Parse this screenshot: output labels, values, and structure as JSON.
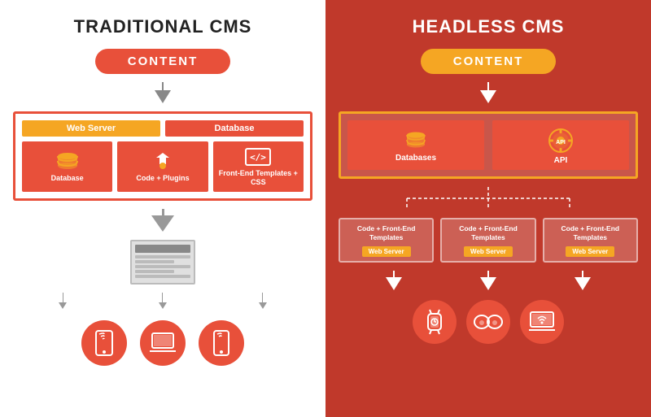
{
  "left": {
    "title": "TRADITIONAL CMS",
    "content_pill": "CONTENT",
    "server_labels": [
      "Web Server",
      "Database"
    ],
    "icon_cells": [
      {
        "label": "Database",
        "icon": "db"
      },
      {
        "label": "Code + Plugins",
        "icon": "plugin"
      },
      {
        "label": "Front-End Templates + CSS",
        "icon": "code"
      }
    ],
    "devices": [
      "📱",
      "💻",
      "📱"
    ]
  },
  "right": {
    "title": "HEADLESS CMS",
    "content_pill": "CONTENT",
    "icon_cells": [
      {
        "label": "Databases",
        "icon": "db"
      },
      {
        "label": "API",
        "icon": "api"
      }
    ],
    "webservers": [
      {
        "text": "Code + Front-End Templates",
        "label": "Web Server"
      },
      {
        "text": "Code + Front-End Templates",
        "label": "Web Server"
      },
      {
        "text": "Code + Front-End Templates",
        "label": "Web Server"
      }
    ],
    "devices": [
      "⌚",
      "🥽",
      "💻"
    ]
  },
  "colors": {
    "orange": "#f5a623",
    "red": "#e8503a",
    "dark_red": "#c0392b",
    "gray": "#888888",
    "white": "#ffffff"
  }
}
